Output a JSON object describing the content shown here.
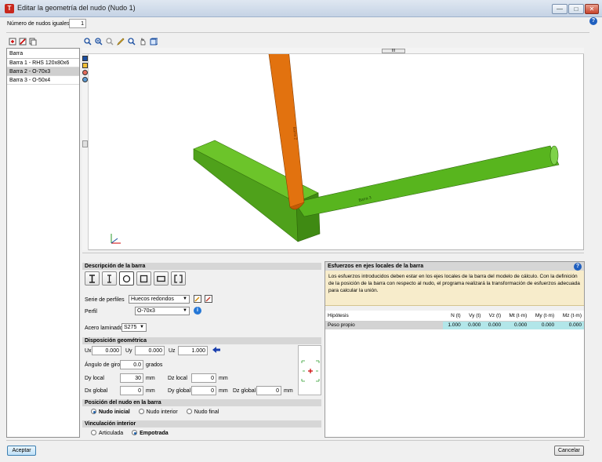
{
  "window": {
    "title": "Editar la geometría del nudo (Nudo 1)",
    "minimize": "—",
    "maximize": "□",
    "close": "✕"
  },
  "top": {
    "equal_nodes_label": "Número de nudos iguales",
    "equal_nodes_value": "1"
  },
  "bars": {
    "header": "Barra",
    "items": [
      {
        "label": "Barra 1 - RHS 120x80x6",
        "selected": false
      },
      {
        "label": "Barra 2 - O-70x3",
        "selected": true
      },
      {
        "label": "Barra 3 - O-50x4",
        "selected": false
      }
    ]
  },
  "viewport": {
    "scroll_grip": "III",
    "bar2_label": "Barra 2",
    "bar3_label": "Barra 3",
    "colors": {
      "bar2": "#e2720f",
      "bar_green": "#58b51e"
    }
  },
  "bar_desc": {
    "title": "Descripción de la barra",
    "series_label": "Serie de perfiles",
    "series_value": "Huecos redondos",
    "profile_label": "Perfil",
    "profile_value": "O-70x3",
    "steel_label": "Acero laminado",
    "steel_value": "S275"
  },
  "geometry": {
    "title": "Disposición geométrica",
    "ux_label": "Ux",
    "ux": "0.000",
    "uy_label": "Uy",
    "uy": "0.000",
    "uz_label": "Uz",
    "uz": "1.000",
    "angle_label": "Ángulo de giro",
    "angle": "0.0",
    "angle_unit": "grados",
    "dy_local_label": "Dy local",
    "dy_local": "30",
    "dz_local_label": "Dz local",
    "dz_local": "0",
    "dx_global_label": "Dx global",
    "dx_global": "0",
    "dy_global_label": "Dy global",
    "dy_global": "0",
    "dz_global_label": "Dz global",
    "dz_global": "0",
    "unit_mm": "mm"
  },
  "node_position": {
    "title": "Posición del nudo en la barra",
    "options": [
      "Nudo inicial",
      "Nudo interior",
      "Nudo final"
    ],
    "selected": 0
  },
  "linkage": {
    "title": "Vinculación interior",
    "options": [
      "Articulada",
      "Empotrada"
    ],
    "selected": 1
  },
  "forces": {
    "title": "Esfuerzos en ejes locales de la barra",
    "note": "Los esfuerzos introducidos deben estar en los ejes locales de la barra del modelo de cálculo. Con la definición de la posición de la barra con respecto al nudo, el programa realizará la transformación de esfuerzos adecuada para calcular la unión.",
    "columns": [
      "Hipótesis",
      "N (t)",
      "Vy (t)",
      "Vz (t)",
      "Mt (t·m)",
      "My (t·m)",
      "Mz (t·m)"
    ],
    "rows": [
      [
        "Peso propio",
        "1.000",
        "0.000",
        "0.000",
        "0.000",
        "0.000",
        "0.000"
      ]
    ]
  },
  "buttons": {
    "accept": "Aceptar",
    "cancel": "Cancelar"
  }
}
